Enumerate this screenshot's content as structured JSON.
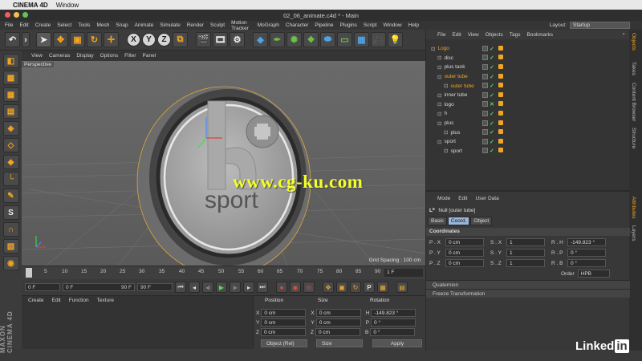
{
  "mac": {
    "apple": "",
    "app": "CINEMA 4D",
    "window": "Window"
  },
  "title": "02_06_animate.c4d * - Main",
  "menu": [
    "File",
    "Edit",
    "Create",
    "Select",
    "Tools",
    "Mesh",
    "Snap",
    "Animate",
    "Simulate",
    "Render",
    "Sculpt",
    "Motion Tracker",
    "MoGraph",
    "Character",
    "Pipeline",
    "Plugins",
    "Script",
    "Window",
    "Help"
  ],
  "layout": {
    "label": "Layout:",
    "value": "Startup"
  },
  "viewport": {
    "menu": [
      "View",
      "Cameras",
      "Display",
      "Options",
      "Filter",
      "Panel"
    ],
    "label": "Perspective",
    "grid_spacing": "Grid Spacing : 100 cm",
    "watermark": "www.cg-ku.com",
    "logo_text": "sport"
  },
  "timeline": {
    "ticks": [
      "0",
      "5",
      "10",
      "15",
      "20",
      "25",
      "30",
      "35",
      "40",
      "45",
      "50",
      "55",
      "60",
      "65",
      "70",
      "75",
      "80",
      "85",
      "90"
    ],
    "current": "1 F"
  },
  "playbar": {
    "start": "0 F",
    "range_start": "0 F",
    "range_end": "90 F",
    "end": "90 F"
  },
  "material": {
    "menu": [
      "Create",
      "Edit",
      "Function",
      "Texture"
    ]
  },
  "coords_mgr": {
    "headers": {
      "position": "Position",
      "size": "Size",
      "rotation": "Rotation"
    },
    "rows": [
      {
        "axis": "X",
        "pos": "0 cm",
        "saxis": "X",
        "size": "0 cm",
        "raxis": "H",
        "rot": "-149.823 °"
      },
      {
        "axis": "Y",
        "pos": "0 cm",
        "saxis": "Y",
        "size": "0 cm",
        "raxis": "P",
        "rot": "0 °"
      },
      {
        "axis": "Z",
        "pos": "0 cm",
        "saxis": "Z",
        "size": "0 cm",
        "raxis": "B",
        "rot": "0 °"
      }
    ],
    "mode": "Object (Rel)",
    "size_mode": "Size",
    "apply": "Apply"
  },
  "objects": {
    "menu": [
      "File",
      "Edit",
      "View",
      "Objects",
      "Tags",
      "Bookmarks"
    ],
    "items": [
      {
        "name": "Logo",
        "indent": 0,
        "hl": true
      },
      {
        "name": "disc",
        "indent": 1,
        "hl": false
      },
      {
        "name": "plus tank",
        "indent": 1,
        "hl": false
      },
      {
        "name": "outer tube",
        "indent": 1,
        "hl": true
      },
      {
        "name": "outer tube",
        "indent": 2,
        "hl": true
      },
      {
        "name": "inner tube",
        "indent": 1,
        "hl": false
      },
      {
        "name": "logo",
        "indent": 1,
        "hl": false
      },
      {
        "name": "h",
        "indent": 1,
        "hl": false
      },
      {
        "name": "plus",
        "indent": 1,
        "hl": false
      },
      {
        "name": "plus",
        "indent": 2,
        "hl": false
      },
      {
        "name": "sport",
        "indent": 1,
        "hl": false
      },
      {
        "name": "sport",
        "indent": 2,
        "hl": false
      }
    ]
  },
  "attributes": {
    "menu": [
      "Mode",
      "Edit",
      "User Data"
    ],
    "title": "Null [outer tube]",
    "tabs": [
      "Basic",
      "Coord.",
      "Object"
    ],
    "section": "Coordinates",
    "rows": [
      {
        "p": "P . X",
        "pv": "0 cm",
        "s": "S . X",
        "sv": "1",
        "r": "R . H",
        "rv": "-149.823 °"
      },
      {
        "p": "P . Y",
        "pv": "0 cm",
        "s": "S . Y",
        "sv": "1",
        "r": "R . P",
        "rv": "0 °"
      },
      {
        "p": "P . Z",
        "pv": "0 cm",
        "s": "S . Z",
        "sv": "1",
        "r": "R . B",
        "rv": "0 °"
      }
    ],
    "order_label": "Order",
    "order_value": "HPB",
    "quaternion": "Quaternion",
    "freeze": "Freeze Transformation"
  },
  "side_tabs": [
    "Objects",
    "Takes",
    "Content Browser",
    "Structure",
    "Attributes",
    "Layers"
  ],
  "brand": {
    "maxon": "MAXON CINEMA 4D",
    "linked": "Linked",
    "in": "in"
  }
}
